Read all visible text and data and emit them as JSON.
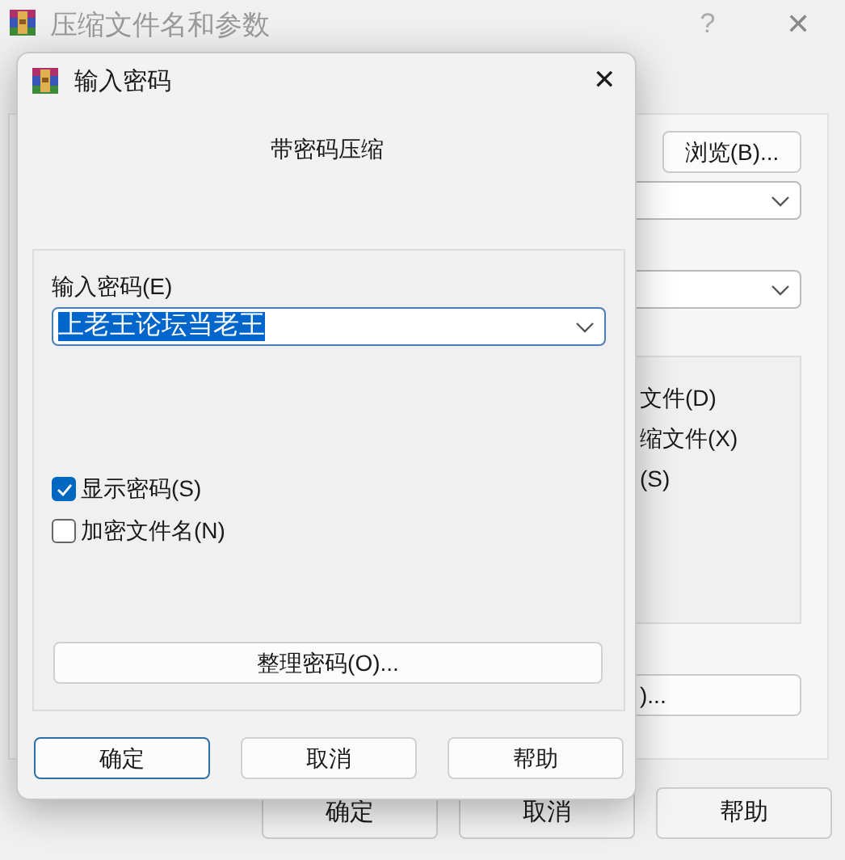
{
  "main_window": {
    "title": "压缩文件名和参数",
    "help": "?",
    "close": "✕",
    "browse_button": "浏览(B)...",
    "options": [
      {
        "label": "文件(D)"
      },
      {
        "label": "缩文件(X)"
      },
      {
        "label": "(S)"
      }
    ],
    "partial_button": ")...",
    "buttons": [
      {
        "label": "确定"
      },
      {
        "label": "取消"
      },
      {
        "label": "帮助"
      }
    ]
  },
  "dialog": {
    "title": "输入密码",
    "close": "✕",
    "heading": "带密码压缩",
    "password_label": "输入密码(E)",
    "password_value": "上老王论坛当老王",
    "password_selected": true,
    "checkboxes": [
      {
        "label": "显示密码(S)",
        "checked": true
      },
      {
        "label": "加密文件名(N)",
        "checked": false
      }
    ],
    "organize_button": "整理密码(O)...",
    "buttons": [
      {
        "label": "确定",
        "default": true
      },
      {
        "label": "取消",
        "default": false
      },
      {
        "label": "帮助",
        "default": false
      }
    ]
  }
}
